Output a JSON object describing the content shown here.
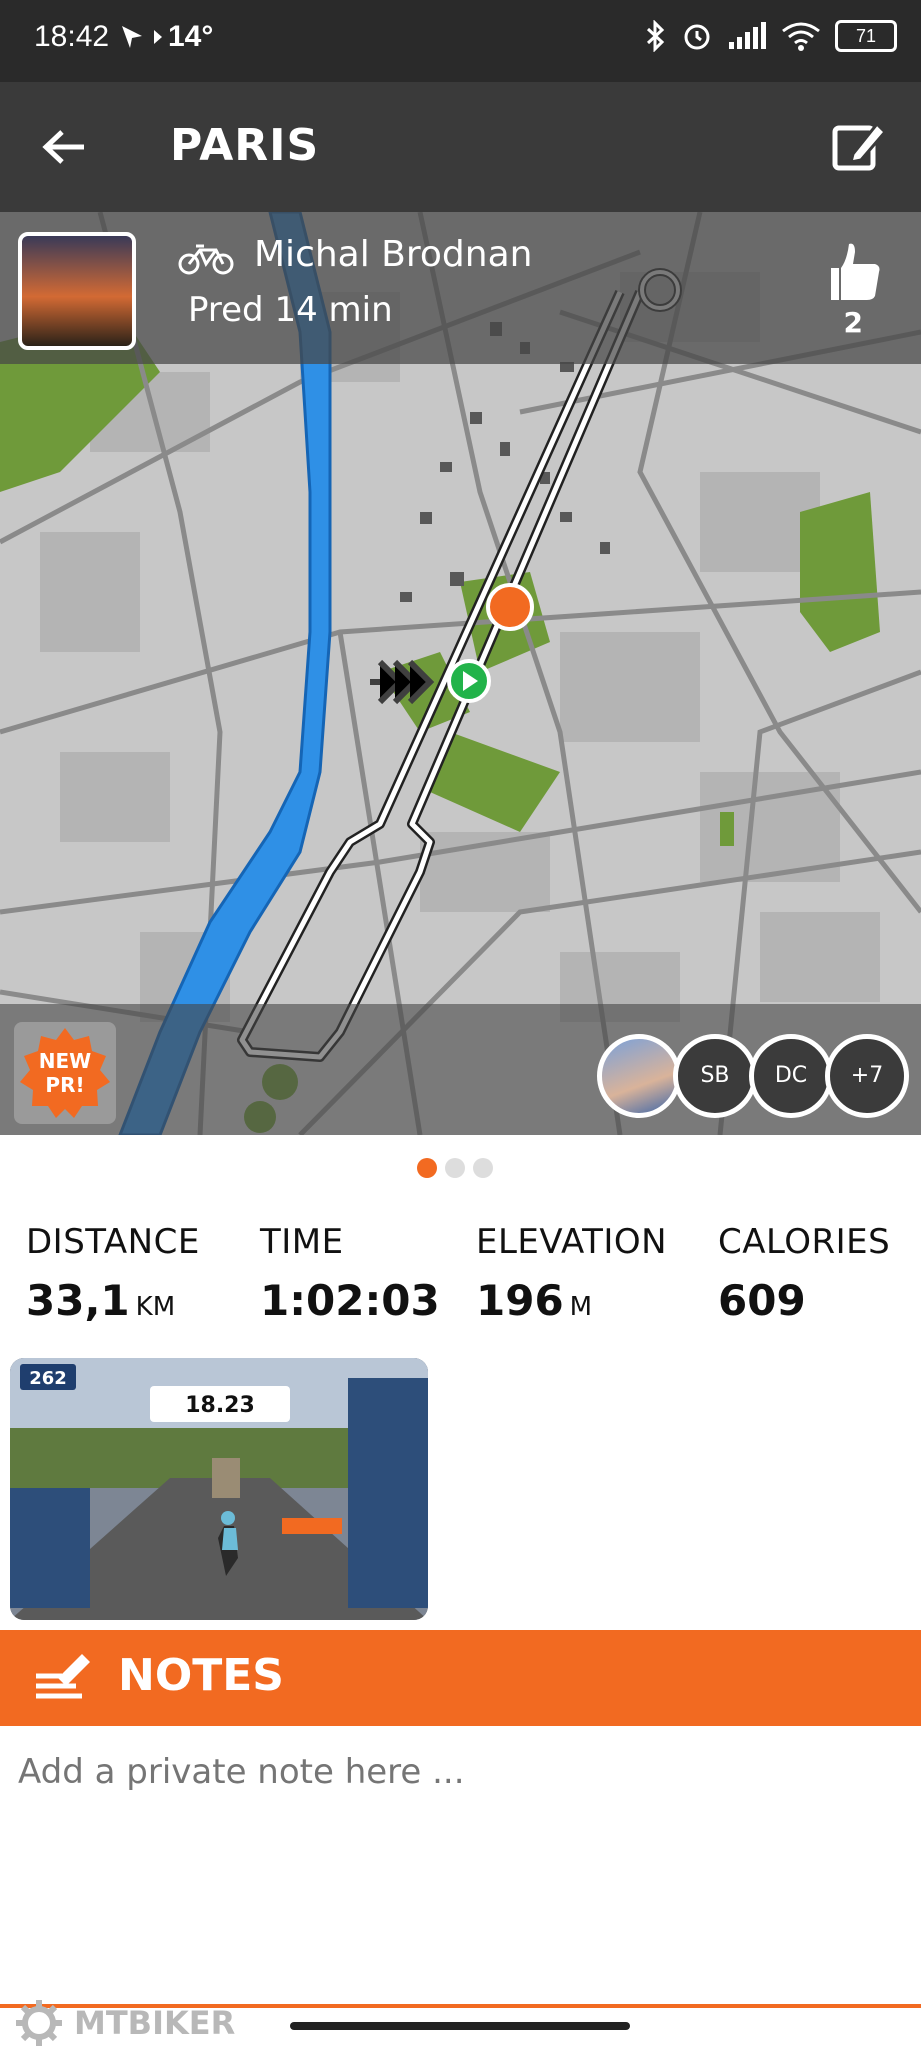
{
  "status_bar": {
    "time": "18:42",
    "temperature": "14°",
    "battery": "71"
  },
  "app_bar": {
    "title": "PARIS",
    "back_icon": "arrow-left-icon",
    "edit_icon": "edit-icon"
  },
  "ride": {
    "rider_name": "Michal Brodnan",
    "time_ago": "Pred 14 min",
    "likes": "2",
    "activity_icon": "bicycle-icon"
  },
  "map": {
    "badge": {
      "line1": "NEW",
      "line2": "PR!"
    },
    "participants": [
      "SB",
      "DC",
      "+7"
    ]
  },
  "pager": {
    "count": 3,
    "active": 0
  },
  "stats": [
    {
      "label": "DISTANCE",
      "value": "33,1",
      "unit": "KM"
    },
    {
      "label": "TIME",
      "value": "1:02:03",
      "unit": ""
    },
    {
      "label": "ELEVATION",
      "value": "196",
      "unit": "M"
    },
    {
      "label": "CALORIES",
      "value": "609",
      "unit": ""
    }
  ],
  "screenshot": {
    "power": "262",
    "timer": "18.23"
  },
  "notes": {
    "title": "NOTES",
    "placeholder": "Add a private note here ..."
  },
  "watermark": "MTBIKER",
  "colors": {
    "accent": "#f26a21",
    "appbar": "#3a3a3a",
    "statusbar": "#2a2a2a",
    "route_start": "#22b34a"
  }
}
